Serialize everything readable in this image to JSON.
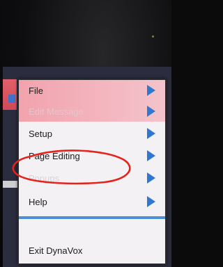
{
  "menu": {
    "items": [
      {
        "label": "File",
        "has_submenu": true,
        "state": "enabled"
      },
      {
        "label": "Edit Message",
        "has_submenu": true,
        "state": "disabled"
      },
      {
        "label": "Setup",
        "has_submenu": true,
        "state": "enabled"
      },
      {
        "label": "Page Editing",
        "has_submenu": true,
        "state": "enabled",
        "highlighted": true
      },
      {
        "label": "Popups",
        "has_submenu": true,
        "state": "disabled"
      },
      {
        "label": "Help",
        "has_submenu": true,
        "state": "enabled"
      }
    ],
    "exit_label": "Exit DynaVox"
  },
  "colors": {
    "menu_pink": "#f2a3ad",
    "arrow_blue": "#2f78cf",
    "separator_blue": "#4a8fd8",
    "annotation_red": "#e5231d"
  },
  "icons": {
    "submenu_arrow": "triangle-right-icon"
  }
}
